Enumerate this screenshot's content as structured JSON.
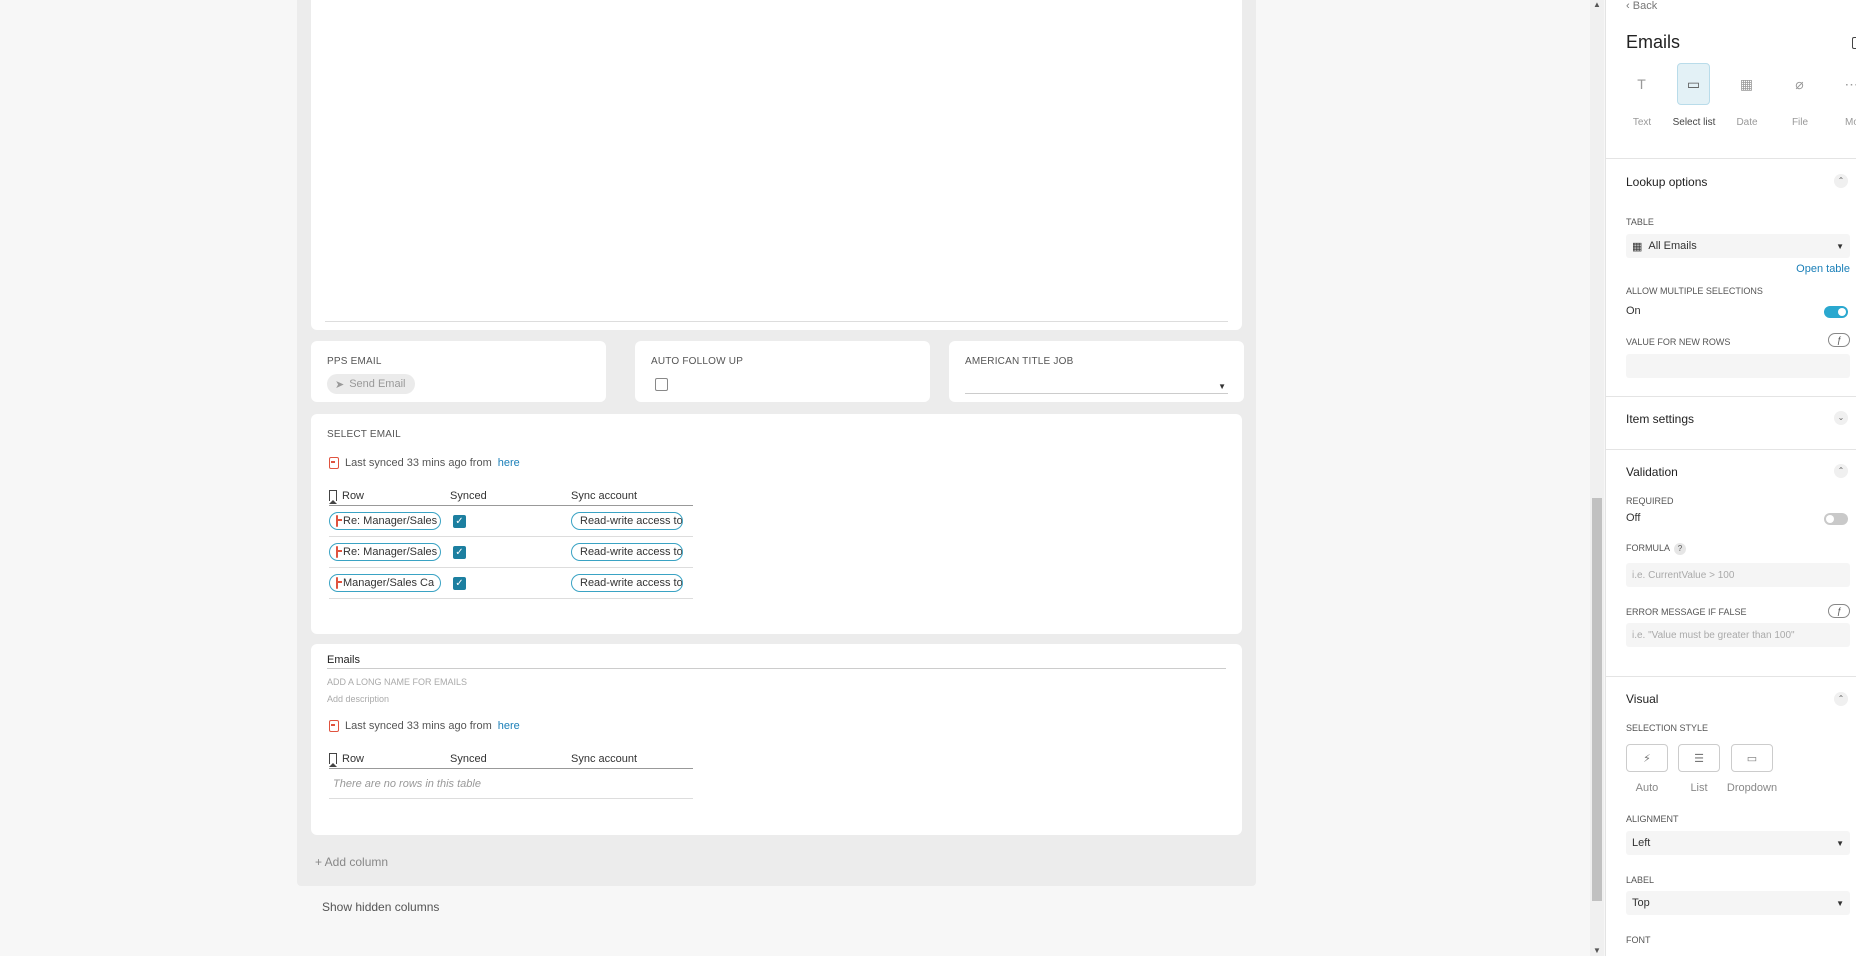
{
  "editor": {
    "fields": [
      {
        "label": "PPS EMAIL",
        "button": "Send Email",
        "icon": "send-icon"
      },
      {
        "label": "AUTO FOLLOW UP",
        "checked": false
      },
      {
        "label": "AMERICAN TITLE JOB",
        "value": ""
      }
    ],
    "select_email": {
      "label": "SELECT EMAIL",
      "sync_text": "Last synced 33 mins ago from",
      "sync_link": "here",
      "columns": [
        "Row",
        "Synced",
        "Sync account"
      ],
      "rows": [
        {
          "row": "Re: Manager/Sales",
          "synced": true,
          "account": "Read-write access to"
        },
        {
          "row": "Re: Manager/Sales",
          "synced": true,
          "account": "Read-write access to"
        },
        {
          "row": "Manager/Sales Ca",
          "synced": true,
          "account": "Read-write access to"
        }
      ]
    },
    "emails": {
      "title": "Emails",
      "long_name_placeholder": "ADD A LONG NAME FOR EMAILS",
      "description_placeholder": "Add description",
      "sync_text": "Last synced 33 mins ago from",
      "sync_link": "here",
      "columns": [
        "Row",
        "Synced",
        "Sync account"
      ],
      "empty_text": "There are no rows in this table"
    },
    "add_column": "+ Add column",
    "show_hidden": "Show hidden columns"
  },
  "panel": {
    "back": "Back",
    "title": "Emails",
    "types": [
      {
        "label": "Text",
        "glyph": "T",
        "icon": "text-icon"
      },
      {
        "label": "Select list",
        "glyph": "▭",
        "icon": "select-list-icon",
        "active": true
      },
      {
        "label": "Date",
        "glyph": "▦",
        "icon": "calendar-icon"
      },
      {
        "label": "File",
        "glyph": "⌀",
        "icon": "paperclip-icon"
      },
      {
        "label": "Mo",
        "glyph": "⋯",
        "icon": "more-icon"
      }
    ],
    "lookup": {
      "title": "Lookup options",
      "table_label": "TABLE",
      "table_value": "All Emails",
      "open_table": "Open table",
      "multi_label": "ALLOW MULTIPLE SELECTIONS",
      "multi_value": "On",
      "new_rows_label": "VALUE FOR NEW ROWS"
    },
    "item_settings": {
      "title": "Item settings"
    },
    "validation": {
      "title": "Validation",
      "required_label": "REQUIRED",
      "required_value": "Off",
      "formula_label": "FORMULA",
      "formula_help": "?",
      "formula_placeholder": "i.e. CurrentValue > 100",
      "error_label": "ERROR MESSAGE IF FALSE",
      "error_placeholder": "i.e. \"Value must be greater than 100\""
    },
    "visual": {
      "title": "Visual",
      "selection_style_label": "SELECTION STYLE",
      "styles": [
        {
          "label": "Auto",
          "glyph": "⚡︎",
          "icon": "auto-icon"
        },
        {
          "label": "List",
          "glyph": "☰",
          "icon": "list-icon"
        },
        {
          "label": "Dropdown",
          "glyph": "▭",
          "icon": "dropdown-icon"
        }
      ],
      "alignment_label": "ALIGNMENT",
      "alignment_value": "Left",
      "label_label": "LABEL",
      "label_value": "Top",
      "font_label": "FONT"
    },
    "fx_glyph": "ƒ"
  },
  "colors": {
    "accent": "#2aa8cf",
    "link": "#1a7fb8",
    "checkbox": "#1c7fa0",
    "doc_icon": "#e0533f"
  }
}
